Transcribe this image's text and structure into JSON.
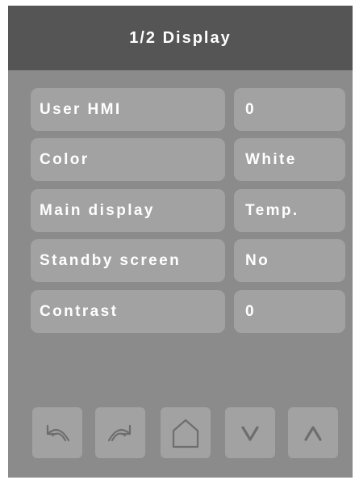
{
  "header": {
    "title": "1/2 Display"
  },
  "rows": [
    {
      "label": "User HMI",
      "value": "0"
    },
    {
      "label": "Color",
      "value": "White"
    },
    {
      "label": "Main display",
      "value": "Temp."
    },
    {
      "label": "Standby screen",
      "value": "No"
    },
    {
      "label": "Contrast",
      "value": "0"
    }
  ],
  "nav": [
    {
      "icon": "undo-arrow-icon"
    },
    {
      "icon": "redo-arrow-icon"
    },
    {
      "icon": "home-icon"
    },
    {
      "icon": "chevron-down-icon"
    },
    {
      "icon": "chevron-up-icon"
    }
  ],
  "colors": {
    "background": "#8b8b8b",
    "header": "#555555",
    "tile": "#a2a2a2",
    "text": "#ffffff",
    "icon": "#6e6e6e"
  }
}
